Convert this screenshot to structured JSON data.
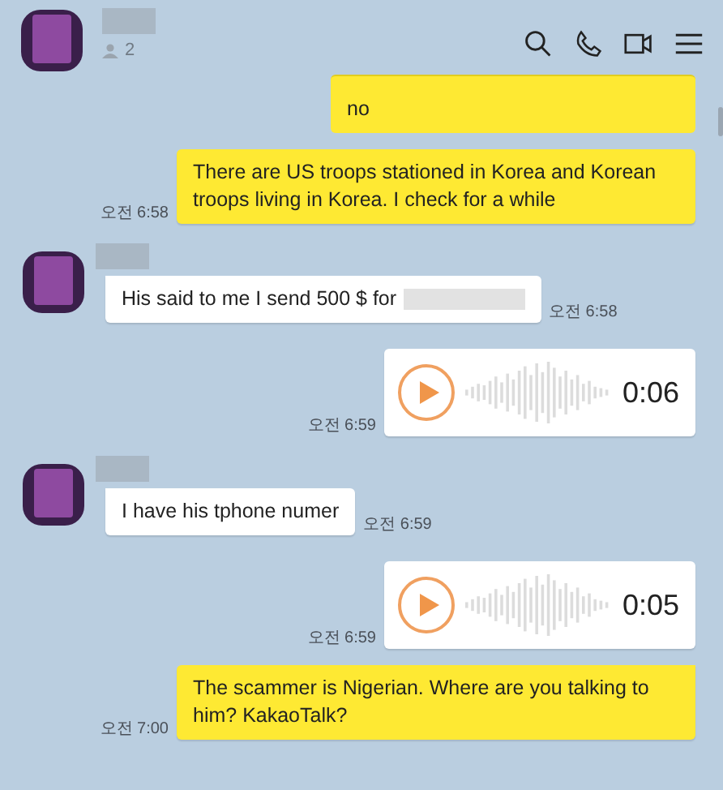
{
  "header": {
    "member_count": "2"
  },
  "messages": [
    {
      "kind": "text",
      "mine": true,
      "first": false,
      "tail": false,
      "quoted": true,
      "text": "no"
    },
    {
      "kind": "text",
      "mine": true,
      "first": false,
      "tail": false,
      "quoted": false,
      "text": "There are US troops stationed in Korea and Korean troops living in Korea.  I check for a while",
      "time": "오전 6:58"
    },
    {
      "kind": "text",
      "mine": false,
      "first": true,
      "tail": true,
      "quoted": false,
      "redacted": true,
      "text": "His said to me I send 500 $ for",
      "time": "오전 6:58"
    },
    {
      "kind": "voice",
      "mine": true,
      "first": false,
      "tail": false,
      "duration": "0:06",
      "time": "오전 6:59"
    },
    {
      "kind": "text",
      "mine": false,
      "first": true,
      "tail": true,
      "quoted": false,
      "text": "I have his tphone numer",
      "time": "오전 6:59"
    },
    {
      "kind": "voice",
      "mine": true,
      "first": false,
      "tail": false,
      "duration": "0:05",
      "time": "오전 6:59"
    },
    {
      "kind": "text",
      "mine": true,
      "first": false,
      "tail": true,
      "quoted": false,
      "text": "The scammer is Nigerian. Where are you talking to him? KakaoTalk?",
      "time": "오전 7:00"
    }
  ]
}
